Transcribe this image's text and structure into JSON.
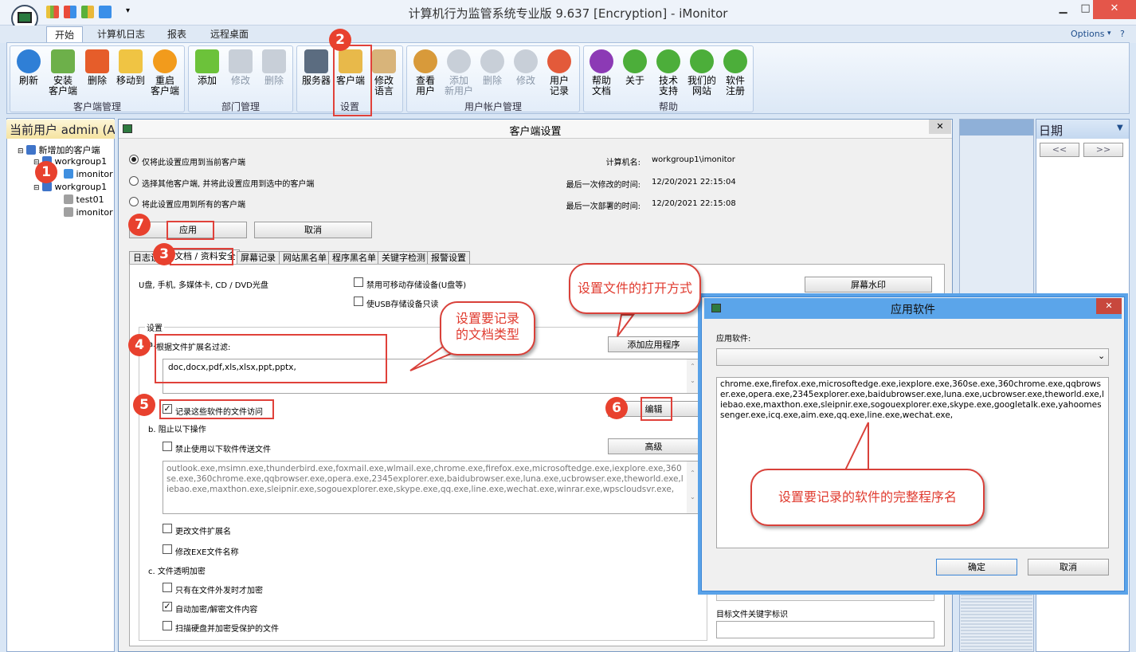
{
  "window": {
    "title": "计算机行为监管系统专业版 9.637 [Encryption] - iMonitor",
    "options": "Options"
  },
  "ribbon": {
    "tabs": [
      "开始",
      "计算机日志",
      "报表",
      "远程桌面"
    ],
    "groups": [
      {
        "label": "客户端管理",
        "buttons": [
          {
            "label": "刷新"
          },
          {
            "label": "安装\n客户端"
          },
          {
            "label": "删除"
          },
          {
            "label": "移动到"
          },
          {
            "label": "重启\n客户端"
          }
        ]
      },
      {
        "label": "部门管理",
        "buttons": [
          {
            "label": "添加"
          },
          {
            "label": "修改"
          },
          {
            "label": "删除"
          }
        ]
      },
      {
        "label": "设置",
        "buttons": [
          {
            "label": "服务器"
          },
          {
            "label": "客户端"
          },
          {
            "label": "修改\n语言"
          }
        ]
      },
      {
        "label": "用户帐户管理",
        "buttons": [
          {
            "label": "查看\n用户"
          },
          {
            "label": "添加\n新用户"
          },
          {
            "label": "删除"
          },
          {
            "label": "修改"
          },
          {
            "label": "用户\n记录"
          }
        ]
      },
      {
        "label": "帮助",
        "buttons": [
          {
            "label": "帮助\n文档"
          },
          {
            "label": "关于"
          },
          {
            "label": "技术\n支持"
          },
          {
            "label": "我们的\n网站"
          },
          {
            "label": "软件\n注册"
          }
        ]
      }
    ]
  },
  "left": {
    "header": "当前用户 admin (A",
    "tree": [
      "新增加的客户端",
      "workgroup1",
      "imonitor",
      "workgroup1",
      "test01",
      "imonitor"
    ]
  },
  "dialog": {
    "title": "客户端设置",
    "radios": [
      "仅将此设置应用到当前客户端",
      "选择其他客户端, 并将此设置应用到选中的客户端",
      "将此设置应用到所有的客户端"
    ],
    "info": [
      {
        "label": "计算机名:",
        "value": "workgroup1\\imonitor"
      },
      {
        "label": "最后一次修改的时间:",
        "value": "12/20/2021 22:15:04"
      },
      {
        "label": "最后一次部署的时间:",
        "value": "12/20/2021 22:15:08"
      }
    ],
    "apply": "应用",
    "cancel": "取消",
    "tabs": [
      "日志设",
      "文档 / 资料安全",
      "屏幕记录",
      "网站黑名单",
      "程序黑名单",
      "关键字检测",
      "报警设置"
    ],
    "usb_text": "U盘, 手机, 多媒体卡, CD / DVD光盘",
    "usb_cb1": "禁用可移动存储设备(U盘等)",
    "usb_cb2": "使USB存储设备只读",
    "watermark": "屏幕水印",
    "settings": "设置",
    "section_a": "根据文件扩展名过滤:",
    "ext_filter": "doc,docx,pdf,xls,xlsx,ppt,pptx,",
    "add_app": "添加应用程序",
    "record_cb": "记录这些软件的文件访问",
    "edit": "编辑",
    "section_b": "b. 阻止以下操作",
    "block_cb": "禁止使用以下软件传送文件",
    "advanced": "高级",
    "block_list": "outlook.exe,msimn.exe,thunderbird.exe,foxmail.exe,wlmail.exe,chrome.exe,firefox.exe,microsoftedge.exe,iexplore.exe,360se.exe,360chrome.exe,qqbrowser.exe,opera.exe,2345explorer.exe,baidubrowser.exe,luna.exe,ucbrowser.exe,theworld.exe,liebao.exe,maxthon.exe,sleipnir.exe,sogouexplorer.exe,skype.exe,qq.exe,line.exe,wechat.exe,winrar.exe,wpscloudsvr.exe,",
    "cb_ext": "更改文件扩展名",
    "cb_exe": "修改EXE文件名称",
    "section_c": "c. 文件透明加密",
    "cb_c1": "只有在文件外发时才加密",
    "cb_c2": "自动加密/解密文件内容",
    "cb_c3": "扫描硬盘并加密受保护的文件",
    "keyword_label": "目标文件关键字标识"
  },
  "calendar": {
    "title": "日期",
    "prev": "<<",
    "next": ">>"
  },
  "app_dialog": {
    "title": "应用软件",
    "label": "应用软件:",
    "list": "chrome.exe,firefox.exe,microsoftedge.exe,iexplore.exe,360se.exe,360chrome.exe,qqbrowser.exe,opera.exe,2345explorer.exe,baidubrowser.exe,luna.exe,ucbrowser.exe,theworld.exe,liebao.exe,maxthon.exe,sleipnir.exe,sogouexplorer.exe,skype.exe,googletalk.exe,yahoomessenger.exe,icq.exe,aim.exe,qq.exe,line.exe,wechat.exe,",
    "ok": "确定",
    "cancel": "取消"
  },
  "annotations": {
    "numbers": [
      "1",
      "2",
      "3",
      "4",
      "5",
      "6",
      "7"
    ],
    "callout_open": "设置文件的打开方式",
    "callout_doc": "设置要记录\n的文档类型",
    "callout_prog": "设置要记录的软件的完整程序名"
  }
}
